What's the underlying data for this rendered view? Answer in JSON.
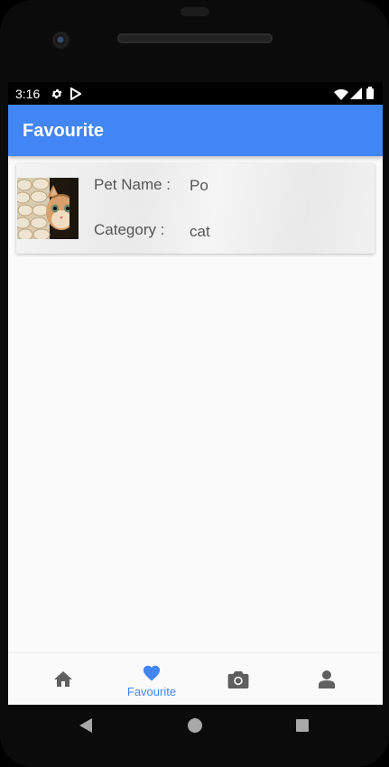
{
  "status_bar": {
    "time": "3:16"
  },
  "app_bar": {
    "title": "Favourite"
  },
  "pet_card": {
    "name_label": "Pet Name :",
    "name_value": "Po",
    "category_label": "Category :",
    "category_value": "cat"
  },
  "bottom_nav": {
    "active_label": "Favourite",
    "items": [
      {
        "icon": "home-icon"
      },
      {
        "icon": "heart-icon",
        "label": "Favourite"
      },
      {
        "icon": "camera-icon"
      },
      {
        "icon": "person-icon"
      }
    ],
    "active_color": "#4285f4",
    "inactive_color": "#5f5f5f"
  },
  "colors": {
    "primary": "#4285f4",
    "background": "#fafafa"
  }
}
